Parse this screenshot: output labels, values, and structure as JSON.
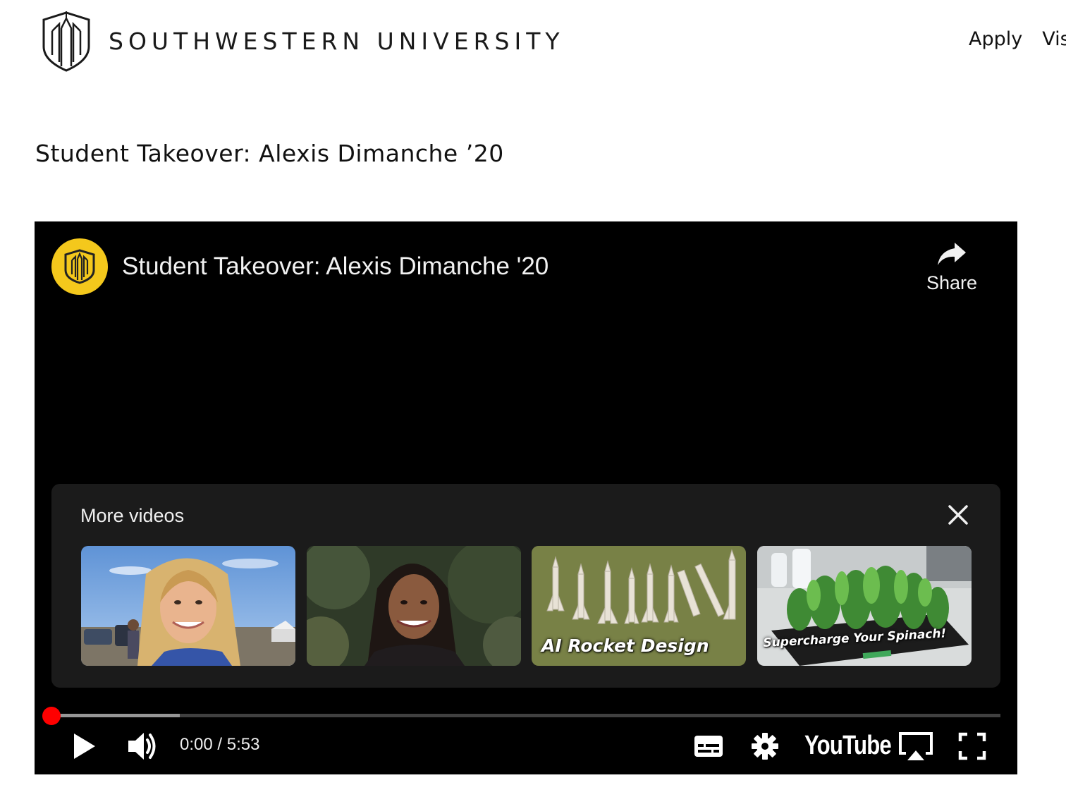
{
  "header": {
    "university_name": "SOUTHWESTERN UNIVERSITY",
    "nav": [
      {
        "label": "Apply"
      },
      {
        "label": "Vis"
      }
    ]
  },
  "page": {
    "title": "Student Takeover: Alexis Dimanche ’20"
  },
  "player": {
    "video_title": "Student Takeover: Alexis Dimanche '20",
    "share_label": "Share",
    "more_videos": {
      "title": "More videos",
      "thumbnails": [
        {
          "caption": ""
        },
        {
          "caption": ""
        },
        {
          "caption": "AI Rocket Design"
        },
        {
          "caption": "Supercharge Your Spinach!"
        }
      ]
    },
    "time": {
      "current": "0:00",
      "separator": "/",
      "duration": "5:53",
      "display": "0:00 / 5:53"
    },
    "progress": {
      "played_fraction": 0.0,
      "buffered_fraction": 0.135
    },
    "brand": "YouTube",
    "accent_color": "#ff0000",
    "channel_color": "#f4c81c",
    "icons": [
      "play-icon",
      "volume-icon",
      "subtitles-icon",
      "settings-icon",
      "airplay-icon",
      "fullscreen-icon",
      "share-icon",
      "close-icon"
    ]
  }
}
